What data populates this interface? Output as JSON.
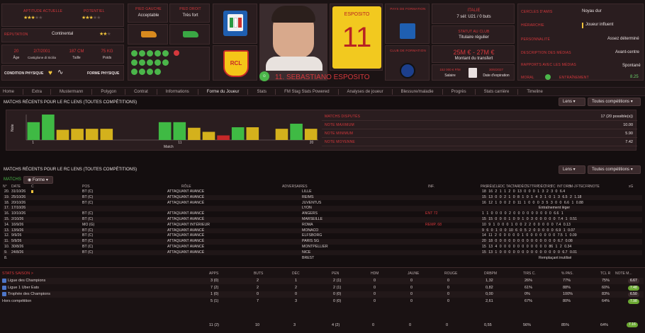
{
  "player": {
    "number_name": "11. SEBASTIANO ESPOSITO",
    "shirt_name": "ESPOSITO",
    "shirt_number": "11",
    "nation": "ITALIE",
    "caps": "7 sél: U21 / 0 buts",
    "club_status_label": "STATUT AU CLUB",
    "club_status": "Titulaire régulier",
    "transfer_value": "25M € - 27M €",
    "transfer_label": "Montant du transfert",
    "salary": "152 000 € P/M",
    "salary_label": "Salaire",
    "expiry": "30/6/2027",
    "expiry_label": "Date d'expiration",
    "reputation_label": "RÉPUTATION",
    "reputation": "Continental",
    "age": "20",
    "age_label": "Âge",
    "birth": "2/7/2001",
    "birthplace": "Castiglione di Sicilia",
    "height": "187 CM",
    "height_label": "Taille",
    "weight": "75 KG",
    "weight_label": "Poids",
    "left_foot_label": "PIED GAUCHE",
    "left_foot": "Acceptable",
    "right_foot_label": "PIED DROIT",
    "right_foot": "Très fort",
    "current_ability_label": "APTITUDE ACTUELLE",
    "potential_label": "POTENTIEL",
    "condition_label": "CONDITION PHYSIQUE",
    "form_label": "FORME PHYSIQUE",
    "birth_nation_label": "PAYS DE FORMATION",
    "training_club_label": "CLUB DE FORMATION",
    "circle_label": "CERCLES D'AMIS",
    "circle": "Noyau dur",
    "hierarchy_label": "HIÉRARCHIE",
    "hierarchy": "Joueur influent",
    "personality_label": "PERSONNALITÉ",
    "personality": "Assez déterminé",
    "media_label": "DESCRIPTION DES MÉDIAS",
    "media": "Avant-centre",
    "media_rel_label": "RAPPORTS AVEC LES MÉDIAS",
    "media_rel": "Spontané",
    "morale_label": "MORAL",
    "training_label": "ENTRAÎNEMENT",
    "training": "8.25",
    "club_badge_text": "RCL"
  },
  "nav": [
    "Home",
    "Extra",
    "Mustermann",
    "Polygon",
    "Contrat",
    "Informations",
    "Forme du Joueur",
    "Stats",
    "FM Stag Stats Powered",
    "Analyses de joueur",
    "Blessure/maladie",
    "Progrès",
    "Stats carrière",
    "Timeline"
  ],
  "nav_active": "Forme du Joueur",
  "recent": {
    "title": "MATCHS RÉCENTS POUR LE RC LENS (TOUTES COMPÉTITIONS)",
    "dd_club": "Lens",
    "dd_comp": "Toutes compétitions",
    "ylabel": "Note",
    "xlabel": "Match",
    "ticks": [
      "1",
      "11",
      "20"
    ],
    "stat_labels": [
      "MATCHS DISPUTÉS",
      "NOTE MAXIMUM",
      "NOTE MINIMUM",
      "NOTE MOYENNE"
    ],
    "stat_values": [
      "17 (20 possible(s))",
      "10.00",
      "5.90",
      "7.42"
    ]
  },
  "chart_data": {
    "type": "bar",
    "categories": [
      "1",
      "2",
      "3",
      "4",
      "5",
      "6",
      "7",
      "8",
      "9",
      "10",
      "11",
      "12",
      "13",
      "14",
      "15",
      "16",
      "17",
      "18",
      "19",
      "20"
    ],
    "values": [
      8.5,
      10,
      7,
      7.2,
      7.2,
      7.2,
      null,
      null,
      null,
      8.5,
      8.5,
      7.4,
      6.6,
      5.9,
      7.5,
      7.5,
      null,
      7.2,
      8.2,
      7.2
    ],
    "colors": [
      "g",
      "g",
      "y",
      "y",
      "y",
      "y",
      null,
      null,
      null,
      "g",
      "g",
      "y",
      "y",
      "r",
      "g",
      "y",
      null,
      "y",
      "g",
      "y"
    ],
    "ylabel": "Note",
    "xlabel": "Match"
  },
  "matches": {
    "title": "MATCHS RÉCENTS POUR LE RC LENS (TOUTES COMPÉTITIONS)",
    "dd_club": "Lens",
    "dd_comp": "Toutes compétitions",
    "tab": "MATCHS",
    "filter": "Forme",
    "headers": [
      "N°",
      "DATE",
      "C",
      "POS",
      "RÔLE",
      "ADVERSAIRES",
      "INF.",
      "PAS",
      "RÉU",
      "CLE",
      "OC",
      "TAC",
      "TAR",
      "DÉC",
      "TET",
      "TRP",
      "DÉC",
      "TIRS",
      "TC",
      "INT",
      "DRB",
      "M-J",
      "FTE",
      "CFR",
      "NOTE",
      "xG"
    ],
    "rows": [
      {
        "n": "20.",
        "date": "31/10/26",
        "pos": "BT (C)",
        "role": "ATTAQUANT AVANCÉ",
        "opp": "LILLE",
        "inf": "",
        "stats": "18 16 2 1 1 2 0 13 0 0 0 1 3 2 3 0 6.4"
      },
      {
        "n": "19.",
        "date": "25/10/26",
        "pos": "BT (C)",
        "role": "ATTAQUANT AVANCÉ",
        "opp": "REIMS",
        "inf": "",
        "stats": "15 13 0 0 2 1 0 8 1 0 1 4 3 1 0 1 3 6.5 2 1.18"
      },
      {
        "n": "18.",
        "date": "20/10/26",
        "pos": "BT (C)",
        "role": "ATTAQUANT AVANCÉ",
        "opp": "JUVENTUS",
        "inf": "",
        "stats": "16 12 1 0 0 2 0 11 1 0 0 0 3 5 3 0 0 6.6 1 0.88"
      },
      {
        "n": "17.",
        "date": "17/10/26",
        "pos": "",
        "role": "",
        "opp": "LYON",
        "inf": "",
        "stats": "Entraînement léger"
      },
      {
        "n": "16.",
        "date": "10/10/26",
        "pos": "BT (C)",
        "role": "ATTAQUANT AVANCÉ",
        "opp": "ANGERS",
        "inf": "ENT 72",
        "stats": "1 1 0 0 0 0 2 0 0 0 0 0 0 0 0 0 6.6 1"
      },
      {
        "n": "15.",
        "date": "2/10/26",
        "pos": "BT (C)",
        "role": "ATTAQUANT AVANCÉ",
        "opp": "MARSEILLE",
        "inf": "",
        "stats": "15 15 0 0 0 1 0 9 1 0 3 0 0 0 0 0 7.4 1 0.51"
      },
      {
        "n": "14.",
        "date": "16/9/26",
        "pos": "MO (G)",
        "role": "ATTAQUANT INTÉRIEUR",
        "opp": "ROMA",
        "inf": "REMP. 68",
        "stats": "10 9 1 0 0 0 1 0 0 2 2 0 0 0 0 0 7.4 0.13"
      },
      {
        "n": "13.",
        "date": "13/9/26",
        "pos": "BT (C)",
        "role": "ATTAQUANT AVANCÉ",
        "opp": "MONACO",
        "inf": "",
        "stats": "9 6 0 1 0 0 10 6 0 5 2 0 0 0 0 0 6.9 1 0.07"
      },
      {
        "n": "12.",
        "date": "9/9/26",
        "pos": "BT (C)",
        "role": "ATTAQUANT AVANCÉ",
        "opp": "ELFSBORG",
        "inf": "",
        "stats": "14 11 2 0 0 0 0 0 1 0 0 0 0 0 0 0 7.5 1 0.09"
      },
      {
        "n": "11.",
        "date": "5/9/26",
        "pos": "BT (C)",
        "role": "ATTAQUANT AVANCÉ",
        "opp": "PARIS SG",
        "inf": "",
        "stats": "20 18 0 0 0 0 0 0 0 0 0 0 0 0 0 0 6.7 0.08"
      },
      {
        "n": "10.",
        "date": "30/8/26",
        "pos": "BT (C)",
        "role": "ATTAQUANT AVANCÉ",
        "opp": "MONTPELLIER",
        "inf": "",
        "stats": "15 13 4 0 0 0 0 0 0 0 0 0 0 0 86 1 2 0.34"
      },
      {
        "n": "9.",
        "date": "24/8/26",
        "pos": "BT (C)",
        "role": "ATTAQUANT AVANCÉ",
        "opp": "NICE",
        "inf": "",
        "stats": "15 13 1 0 0 0 0 0 0 0 0 0 0 0 0 0 0 6.7 0.01"
      },
      {
        "n": "8.",
        "date": "",
        "pos": "",
        "role": "",
        "opp": "BREST",
        "inf": "",
        "stats": "Remplaçant inutilisé"
      }
    ]
  },
  "season": {
    "title": "STATS SAISON >",
    "headers": [
      "APPS",
      "BUTS",
      "DÉC",
      "PEN",
      "HDM",
      "JAUNE",
      "ROUGE",
      "DRBPM",
      "TIRS C.",
      "% PAS.",
      "TCL R",
      "NOTE M..."
    ],
    "rows": [
      {
        "comp": "Ligue des Champions",
        "icon": "trophy-icon",
        "vals": [
          "3 (0)",
          "2",
          "1",
          "2 (1)",
          "0",
          "0",
          "0",
          "1,32",
          "26%",
          "77%",
          "75%"
        ],
        "note": "6.67",
        "nc": "#3a2a2c"
      },
      {
        "comp": "Ligue 1 Uber Eats",
        "icon": "ligue1-icon",
        "vals": [
          "7 (2)",
          "2",
          "2",
          "2 (1)",
          "0",
          "0",
          "0",
          "0,82",
          "61%",
          "88%",
          "60%"
        ],
        "note": "7.48",
        "nc": "#6ba832"
      },
      {
        "comp": "Trophée des Champions",
        "icon": "trophy-icon",
        "vals": [
          "1 (0)",
          "0",
          "0",
          "0 (0)",
          "0",
          "0",
          "0",
          "0,00",
          "0%",
          "100%",
          "83%"
        ],
        "note": "6.50",
        "nc": "#3a2a2c"
      },
      {
        "comp": "Hors compétition",
        "icon": "",
        "vals": [
          "5 (1)",
          "7",
          "3",
          "0 (0)",
          "0",
          "0",
          "0",
          "2,61",
          "67%",
          "80%",
          "64%"
        ],
        "note": "7.98",
        "nc": "#6ba832"
      }
    ],
    "total": {
      "vals": [
        "11 (2)",
        "10",
        "3",
        "4 (2)",
        "0",
        "0",
        "0",
        "0,55",
        "56%",
        "85%",
        "64%"
      ],
      "note": "7.16",
      "nc": "#6ba832"
    }
  }
}
